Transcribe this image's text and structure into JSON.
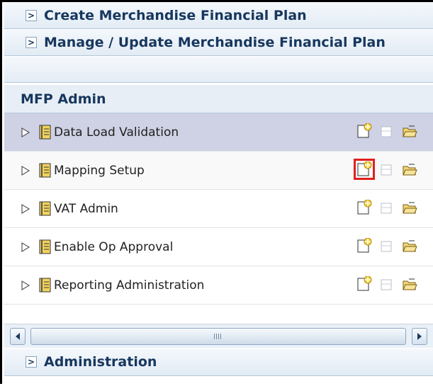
{
  "accordion": {
    "headers": [
      {
        "label": "Create Merchandise Financial Plan",
        "expander": ">"
      },
      {
        "label": "Manage / Update Merchandise Financial Plan",
        "expander": ">"
      }
    ],
    "footer_header": {
      "label": "Administration",
      "expander": ">"
    }
  },
  "section": {
    "title": "MFP Admin"
  },
  "tasks": [
    {
      "label": "Data Load Validation",
      "selected": true
    },
    {
      "label": "Mapping Setup",
      "selected": false,
      "highlighted_action": "create-new"
    },
    {
      "label": "VAT Admin",
      "selected": false
    },
    {
      "label": "Enable Op Approval",
      "selected": false
    },
    {
      "label": "Reporting Administration",
      "selected": false
    }
  ],
  "icons": {
    "disclosure": "triangle-right-icon",
    "task": "task-book-icon",
    "actions": [
      "create-new-icon",
      "open-disabled-icon",
      "open-folder-icon"
    ],
    "scroll_left": "scroll-left-icon",
    "scroll_right": "scroll-right-icon"
  },
  "colors": {
    "header_text": "#17375e",
    "selected_row": "#cfd1e4",
    "highlight": "#e0201d"
  }
}
